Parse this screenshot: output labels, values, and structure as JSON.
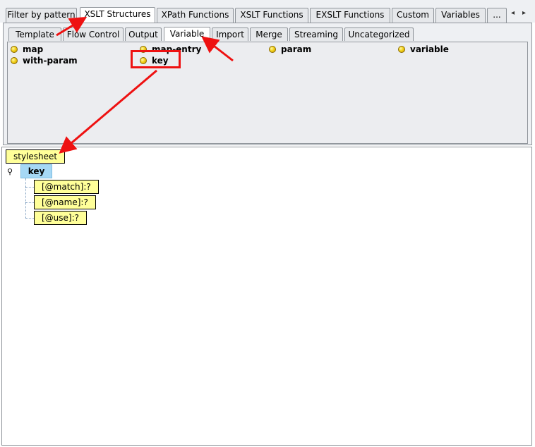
{
  "top_tabs": [
    {
      "label": "Filter by pattern"
    },
    {
      "label": "XSLT Structures"
    },
    {
      "label": "XPath Functions"
    },
    {
      "label": "XSLT Functions"
    },
    {
      "label": "EXSLT Functions"
    },
    {
      "label": "Custom"
    },
    {
      "label": "Variables"
    },
    {
      "label": "..."
    }
  ],
  "active_top_tab": "XSLT Structures",
  "sub_tabs": [
    {
      "label": "Template"
    },
    {
      "label": "Flow Control"
    },
    {
      "label": "Output"
    },
    {
      "label": "Variable"
    },
    {
      "label": "Import"
    },
    {
      "label": "Merge"
    },
    {
      "label": "Streaming"
    },
    {
      "label": "Uncategorized"
    }
  ],
  "active_sub_tab": "Variable",
  "items": [
    {
      "label": "map"
    },
    {
      "label": "map-entry"
    },
    {
      "label": "param"
    },
    {
      "label": "variable"
    },
    {
      "label": "with-param"
    },
    {
      "label": "key"
    }
  ],
  "tree": {
    "root": "stylesheet",
    "selected": "key",
    "children": [
      "[@match]:?",
      "[@name]:?",
      "[@use]:?"
    ]
  },
  "nav": {
    "left": "◂",
    "right": "▸"
  },
  "expander_symbol": "⚲",
  "colors": {
    "annotation": "#ee1111",
    "node_fill": "#ffff99",
    "selected_fill": "#a6d8f5"
  }
}
